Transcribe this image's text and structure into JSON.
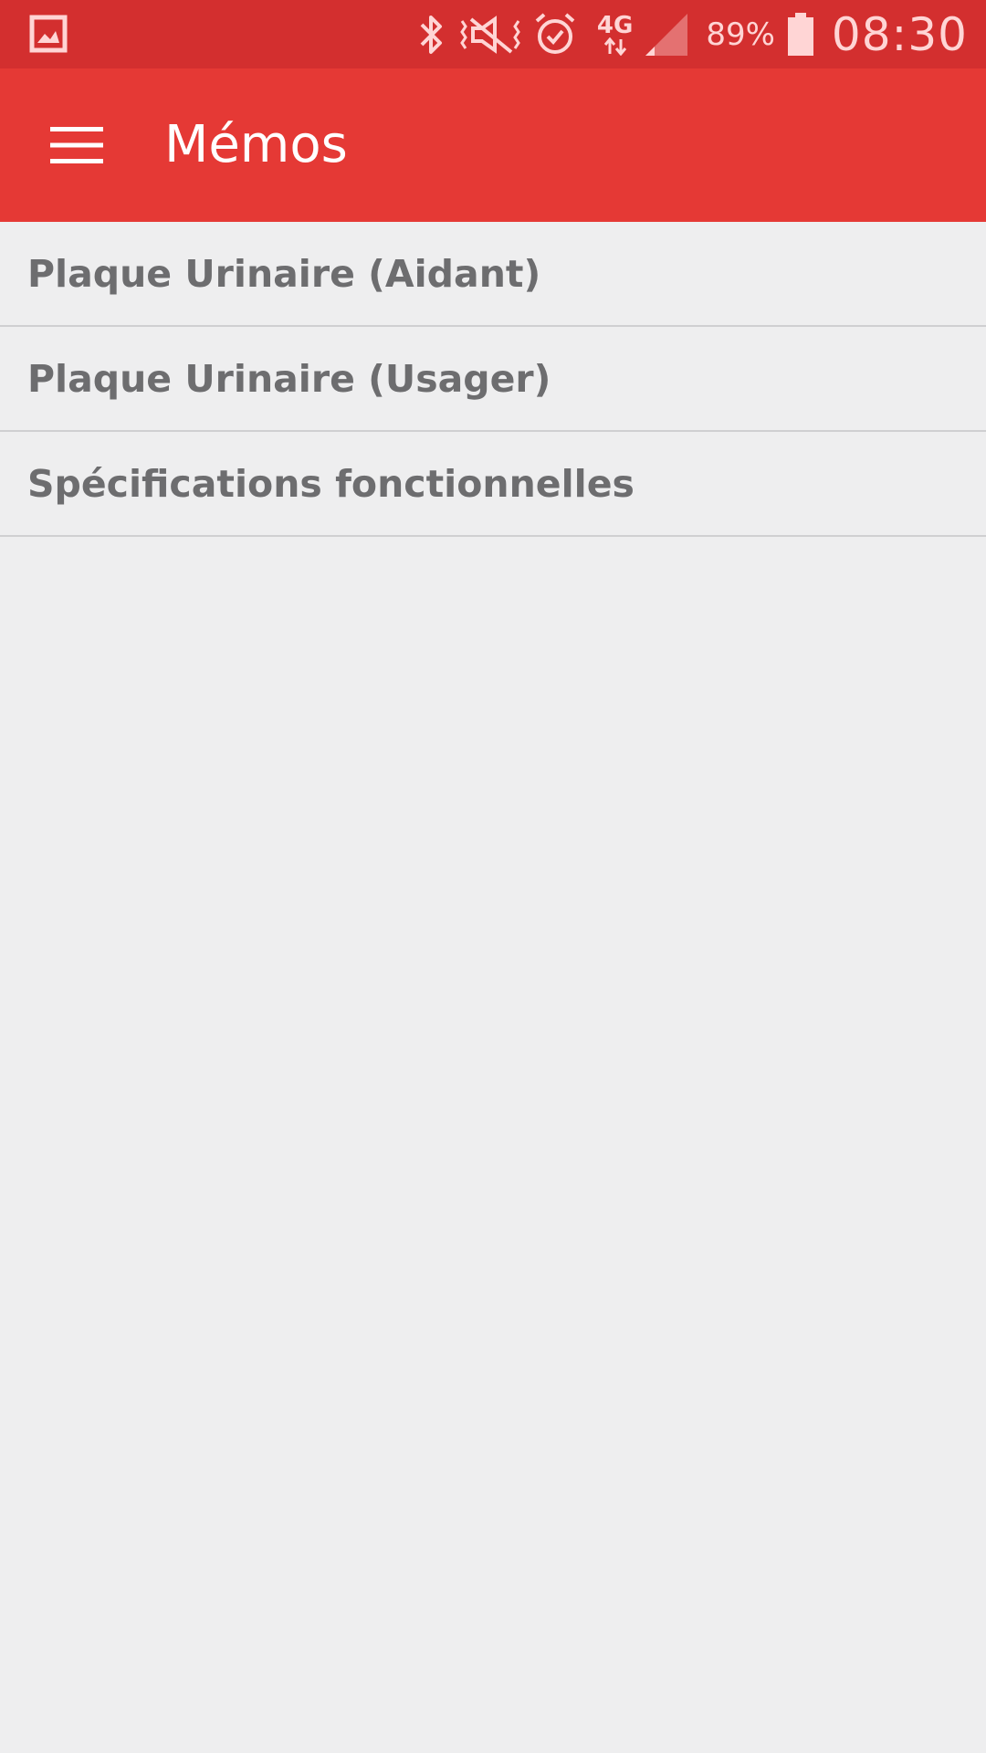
{
  "status_bar": {
    "left_icon": "gallery-icon",
    "icons": [
      "bluetooth-icon",
      "vibrate-off-icon",
      "alarm-icon",
      "network-4g-icon",
      "signal-icon"
    ],
    "network_label": "4G",
    "battery_percent": "89%",
    "battery_icon": "battery-icon",
    "time": "08:30"
  },
  "app_bar": {
    "menu_icon": "hamburger-menu-icon",
    "title": "Mémos",
    "background": "#e53935"
  },
  "memos": [
    {
      "label": "Plaque Urinaire (Aidant)"
    },
    {
      "label": "Plaque Urinaire (Usager)"
    },
    {
      "label": "Spécifications fonctionnelles"
    }
  ]
}
